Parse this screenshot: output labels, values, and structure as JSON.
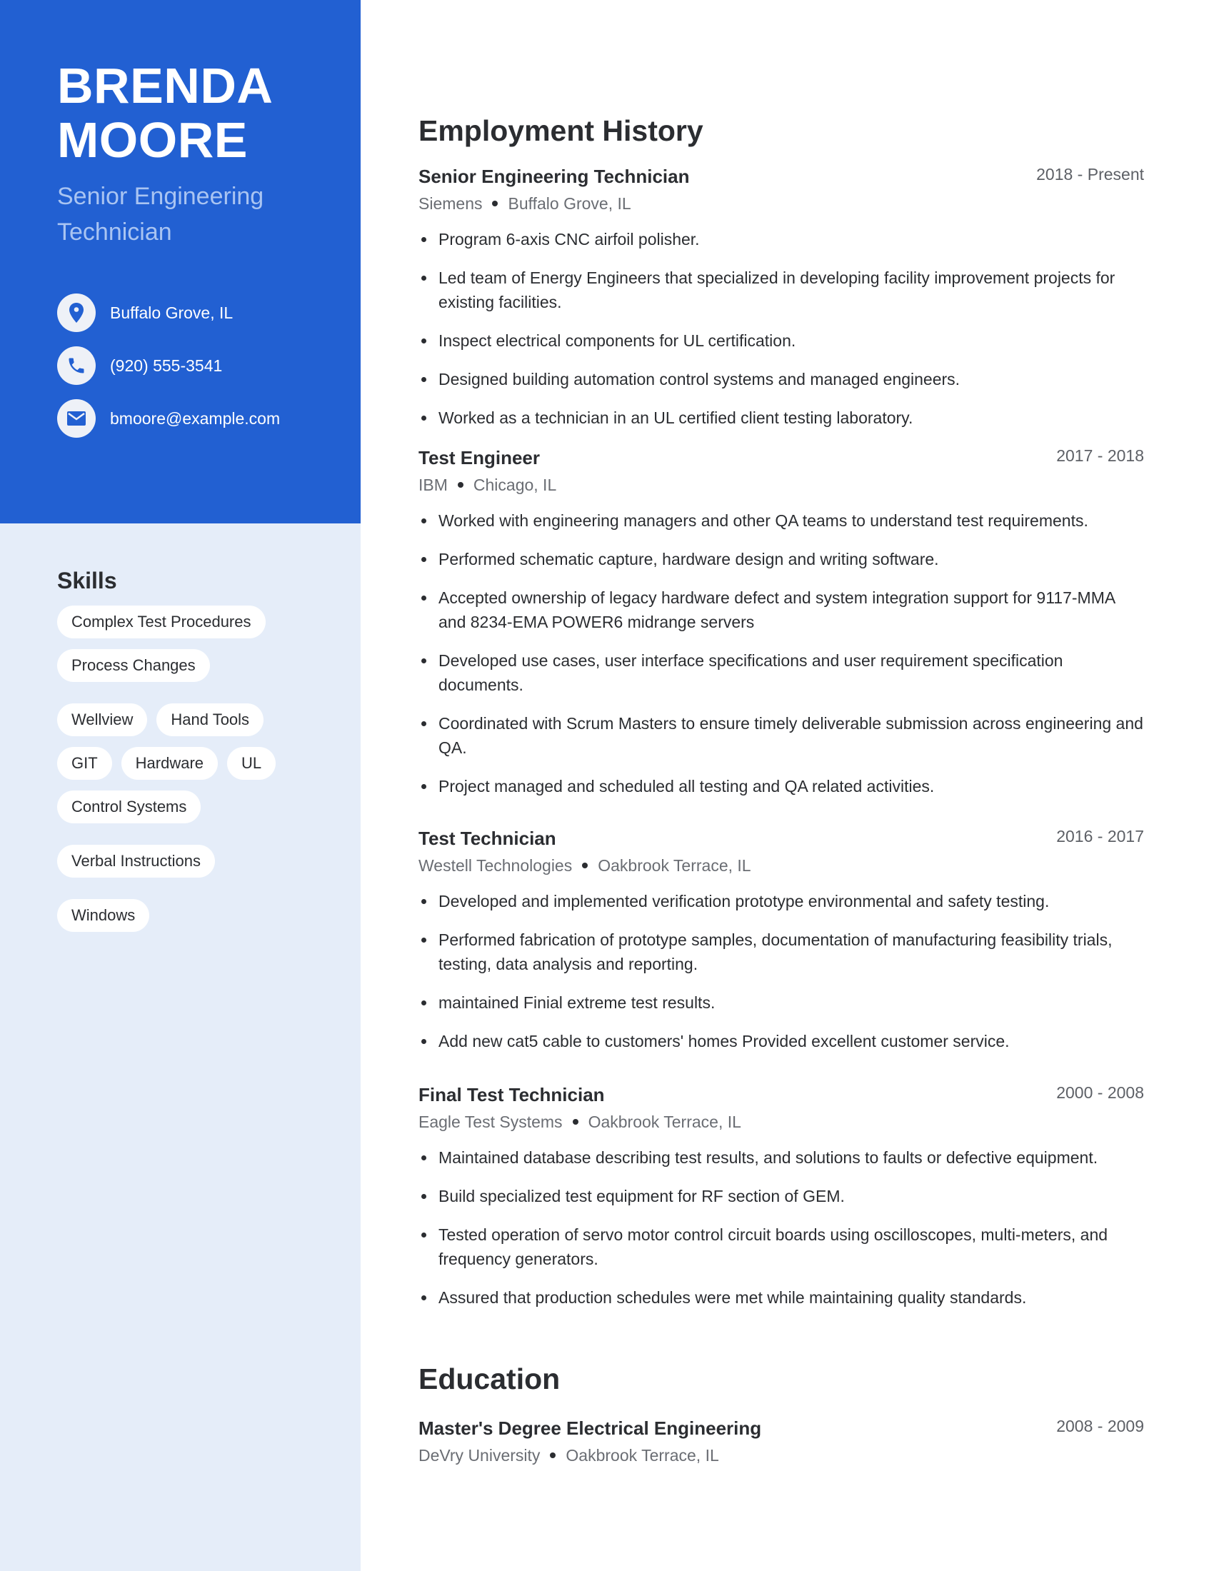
{
  "profile": {
    "first_name": "BRENDA",
    "last_name": "MOORE",
    "title": "Senior Engineering Technician",
    "accent_color": "#2260d2",
    "contacts": [
      {
        "icon": "location-pin-icon",
        "text": "Buffalo Grove, IL"
      },
      {
        "icon": "phone-icon",
        "text": "(920) 555-3541"
      },
      {
        "icon": "mail-icon",
        "text": "bmoore@example.com"
      }
    ]
  },
  "skills": {
    "heading": "Skills",
    "items": [
      "Complex Test Procedures",
      "Process Changes",
      "Wellview",
      "Hand Tools",
      "GIT",
      "Hardware",
      "UL",
      "Control Systems",
      "Verbal Instructions",
      "Windows"
    ]
  },
  "employment": {
    "heading": "Employment History",
    "jobs": [
      {
        "title": "Senior Engineering Technician",
        "dates": "2018 - Present",
        "company": "Siemens",
        "location": "Buffalo Grove, IL",
        "bullets": [
          "Program 6-axis CNC airfoil polisher.",
          "Led team of Energy Engineers that specialized in developing facility improvement projects for existing facilities.",
          "Inspect electrical components for UL certification.",
          "Designed building automation control systems and managed engineers.",
          "Worked as a technician in an UL certified client testing laboratory."
        ]
      },
      {
        "title": "Test Engineer",
        "dates": "2017 - 2018",
        "company": "IBM",
        "location": "Chicago, IL",
        "bullets": [
          "Worked with engineering managers and other QA teams to understand test requirements.",
          "Performed schematic capture, hardware design and writing software.",
          "Accepted ownership of legacy hardware defect and system integration support for 9117-MMA and 8234-EMA POWER6 midrange servers",
          "Developed use cases, user interface specifications and user requirement specification documents.",
          "Coordinated with Scrum Masters to ensure timely deliverable submission across engineering and QA.",
          "Project managed and scheduled all testing and QA related activities."
        ]
      },
      {
        "title": "Test Technician",
        "dates": "2016 - 2017",
        "company": "Westell Technologies",
        "location": "Oakbrook Terrace, IL",
        "bullets": [
          "Developed and implemented verification prototype environmental and safety testing.",
          "Performed fabrication of prototype samples, documentation of manufacturing feasibility trials, testing, data analysis and reporting.",
          "maintained Finial extreme test results.",
          "Add new cat5 cable to customers' homes Provided excellent customer service."
        ]
      },
      {
        "title": "Final Test Technician",
        "dates": "2000 - 2008",
        "company": "Eagle Test Systems",
        "location": "Oakbrook Terrace, IL",
        "bullets": [
          "Maintained database describing test results, and solutions to faults or defective equipment.",
          "Build specialized test equipment for RF section of GEM.",
          "Tested operation of servo motor control circuit boards using oscilloscopes, multi-meters, and frequency generators.",
          "Assured that production schedules were met while maintaining quality standards."
        ]
      }
    ]
  },
  "education": {
    "heading": "Education",
    "entries": [
      {
        "title": "Master's Degree Electrical Engineering",
        "dates": "2008 - 2009",
        "school": "DeVry University",
        "location": "Oakbrook Terrace, IL"
      }
    ]
  }
}
